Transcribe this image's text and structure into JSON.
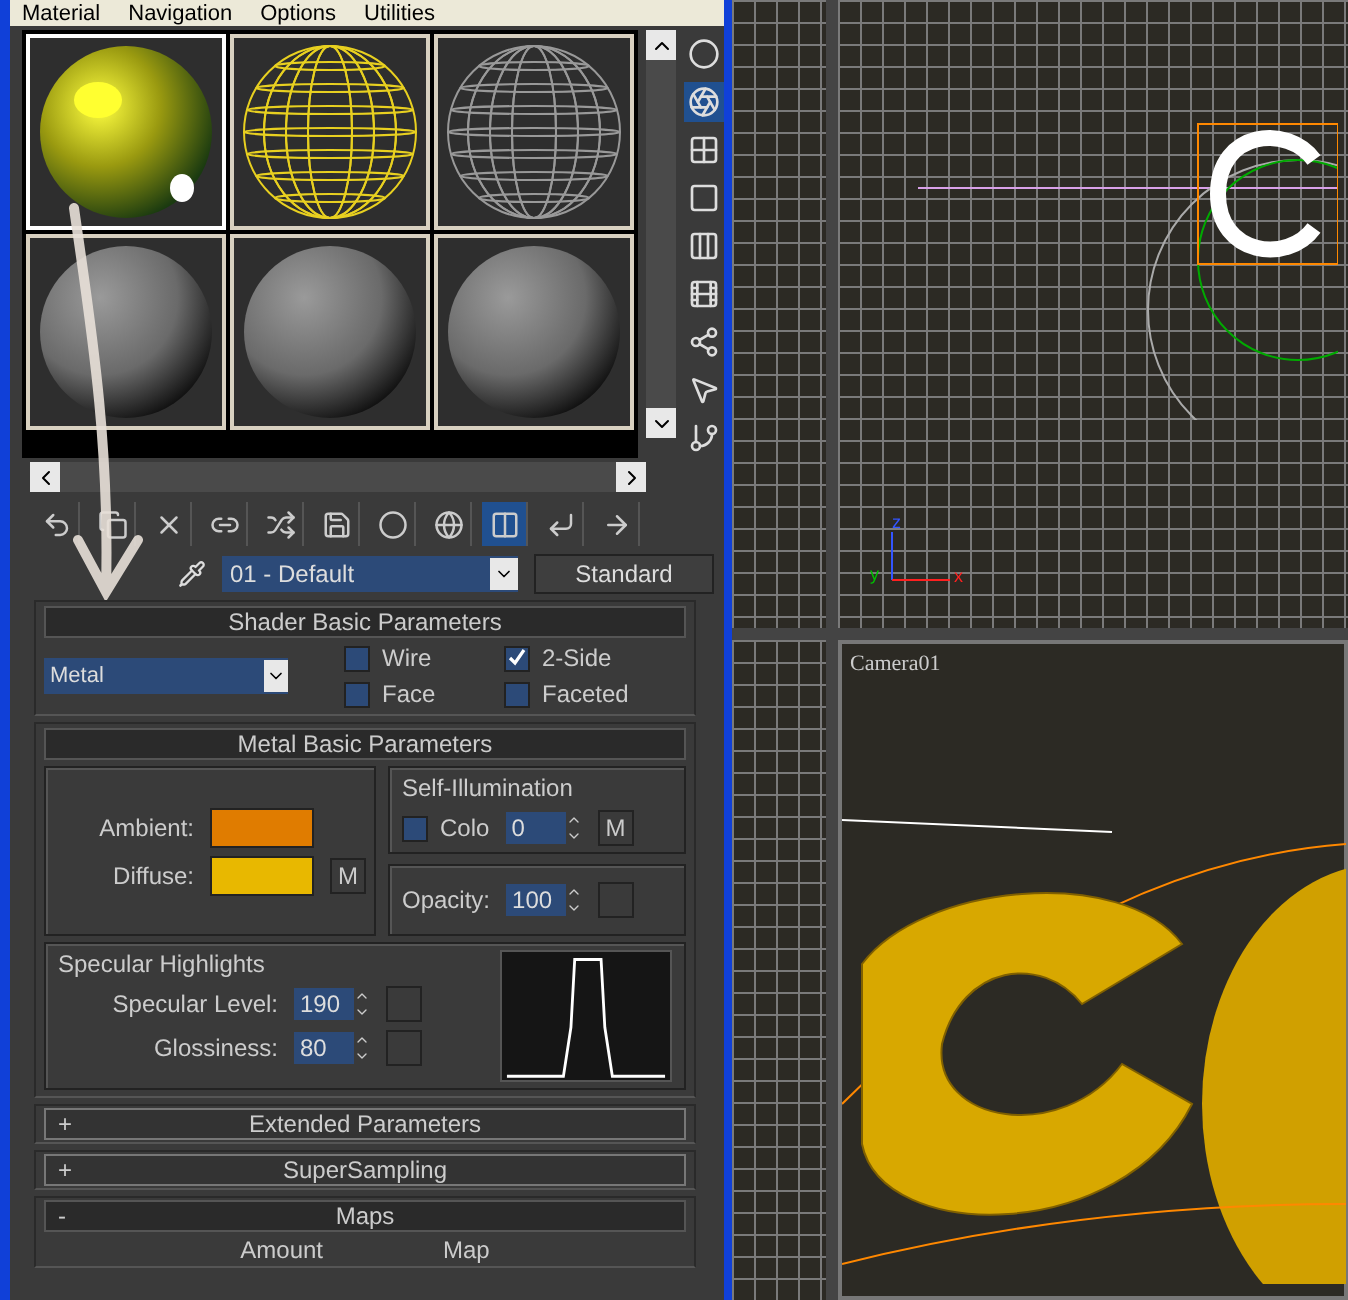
{
  "menu": [
    "Material",
    "Navigation",
    "Options",
    "Utilities"
  ],
  "sample_slots": [
    {
      "kind": "shiny",
      "selected": true
    },
    {
      "kind": "wire-color",
      "selected": false
    },
    {
      "kind": "wire-gray",
      "selected": false
    },
    {
      "kind": "plain",
      "selected": false
    },
    {
      "kind": "plain",
      "selected": false
    },
    {
      "kind": "plain",
      "selected": false
    }
  ],
  "material": {
    "name": "01 - Default",
    "type": "Standard"
  },
  "rollouts": [
    {
      "title": "Shader Basic Parameters",
      "expanded": true,
      "kind": "shader",
      "shader": "Metal",
      "options": [
        {
          "label": "Wire",
          "checked": false
        },
        {
          "label": "2-Side",
          "checked": true
        },
        {
          "label": "Face",
          "checked": false
        },
        {
          "label": "Faceted",
          "checked": false
        }
      ]
    },
    {
      "title": "Metal Basic Parameters",
      "expanded": true,
      "kind": "basic",
      "colors": [
        {
          "label": "Ambient:",
          "color": "#e07c00"
        },
        {
          "label": "Diffuse:",
          "color": "#e8b800",
          "map": "M"
        }
      ],
      "self_illumination": {
        "title": "Self-Illumination",
        "label": "Colo",
        "checked": false,
        "value": "0",
        "map": "M"
      },
      "opacity": {
        "label": "Opacity:",
        "value": "100"
      },
      "specular": {
        "title": "Specular Highlights",
        "fields": [
          {
            "label": "Specular Level:",
            "value": "190"
          },
          {
            "label": "Glossiness:",
            "value": "80"
          }
        ]
      }
    },
    {
      "title": "Extended Parameters",
      "expanded": false,
      "kind": "collapsed",
      "sign": "+"
    },
    {
      "title": "SuperSampling",
      "expanded": false,
      "kind": "collapsed",
      "sign": "+"
    },
    {
      "title": "Maps",
      "expanded": true,
      "kind": "maps",
      "sign": "-",
      "columns": [
        "Amount",
        "Map"
      ]
    }
  ],
  "viewports": {
    "top": {
      "axes": [
        "z",
        "y",
        "x"
      ]
    },
    "camera": {
      "label": "Camera01"
    }
  }
}
